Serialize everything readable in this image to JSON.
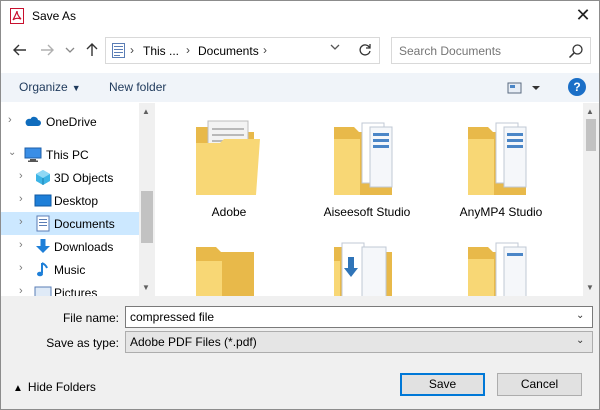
{
  "window": {
    "title": "Save As",
    "close_label": "✕"
  },
  "nav": {
    "back_icon": "arrow-left-icon",
    "forward_icon": "arrow-right-icon",
    "recent_icon": "chevron-down-icon",
    "up_icon": "arrow-up-icon",
    "breadcrumb": [
      {
        "label": "This ..."
      },
      {
        "label": "Documents"
      }
    ],
    "refresh_icon": "refresh-icon",
    "search_placeholder": "Search Documents"
  },
  "toolbar": {
    "organize_label": "Organize",
    "new_folder_label": "New folder",
    "help_label": "?"
  },
  "tree": [
    {
      "label": "OneDrive",
      "icon": "cloud-icon",
      "indent": 0,
      "expanded": false,
      "selected": false
    },
    {
      "label": "This PC",
      "icon": "computer-icon",
      "indent": 0,
      "expanded": true,
      "selected": false
    },
    {
      "label": "3D Objects",
      "icon": "cube-icon",
      "indent": 1,
      "expanded": false,
      "selected": false
    },
    {
      "label": "Desktop",
      "icon": "desktop-icon",
      "indent": 1,
      "expanded": false,
      "selected": false
    },
    {
      "label": "Documents",
      "icon": "documents-icon",
      "indent": 1,
      "expanded": false,
      "selected": true
    },
    {
      "label": "Downloads",
      "icon": "download-icon",
      "indent": 1,
      "expanded": false,
      "selected": false
    },
    {
      "label": "Music",
      "icon": "music-icon",
      "indent": 1,
      "expanded": false,
      "selected": false
    },
    {
      "label": "Pictures",
      "icon": "pictures-icon",
      "indent": 1,
      "expanded": false,
      "selected": false
    }
  ],
  "folders": [
    {
      "name": "Adobe",
      "variant": "document"
    },
    {
      "name": "Aiseesoft Studio",
      "variant": "pages"
    },
    {
      "name": "AnyMP4 Studio",
      "variant": "pages"
    },
    {
      "name": "",
      "variant": "plain"
    },
    {
      "name": "",
      "variant": "download"
    },
    {
      "name": "",
      "variant": "pages"
    }
  ],
  "form": {
    "file_name_label": "File name:",
    "file_name_value": "compressed file",
    "type_label": "Save as type:",
    "type_value": "Adobe PDF Files (*.pdf)"
  },
  "footer": {
    "hide_folders_label": "Hide Folders",
    "save_label": "Save",
    "cancel_label": "Cancel"
  },
  "colors": {
    "accent": "#0078d7",
    "selection": "#cce8ff",
    "folder": "#f8d775",
    "folder_back": "#e8b94a",
    "toolbar_bg": "#f0f4f9"
  }
}
